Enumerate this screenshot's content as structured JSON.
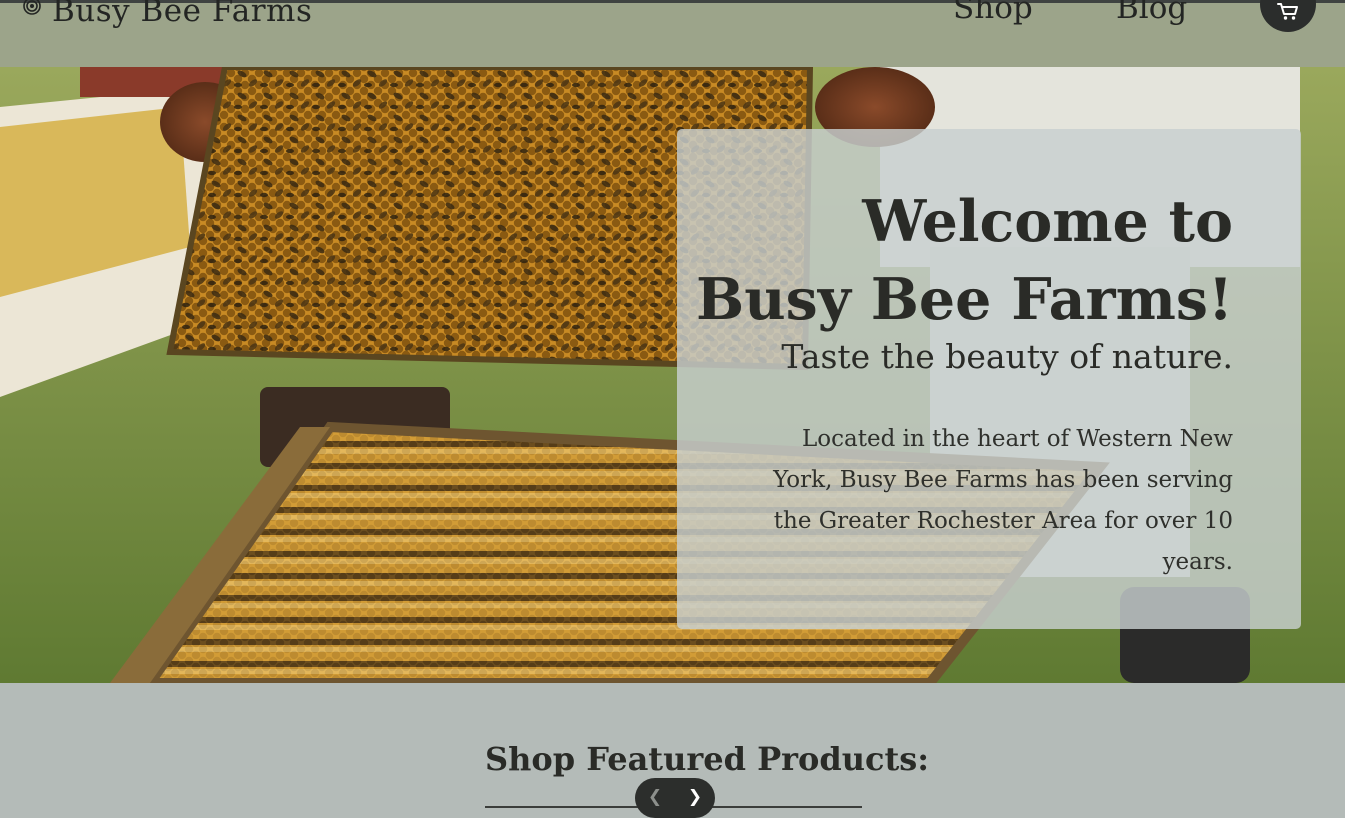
{
  "header": {
    "brand": "Busy Bee Farms",
    "nav": [
      {
        "label": "Shop"
      },
      {
        "label": "Blog"
      }
    ],
    "cart_icon": "cart-icon",
    "logo_icon": "bee-spiral-icon"
  },
  "hero": {
    "title_line1": "Welcome to",
    "title_line2": "Busy Bee Farms!",
    "tagline": "Taste the beauty of nature.",
    "body": "Located in the heart of Western New York, Busy Bee Farms has been serving the Greater Rochester Area for over 10 years."
  },
  "featured": {
    "title": "Shop Featured Products:",
    "prev_icon": "chevron-left-icon",
    "next_icon": "chevron-right-icon"
  },
  "colors": {
    "header_bg": "#9ca48a",
    "page_bg": "#b4bbb8",
    "card_bg": "#c8d0cf",
    "text_dark": "#2a2b27",
    "button_dark": "#2b2d2c"
  }
}
